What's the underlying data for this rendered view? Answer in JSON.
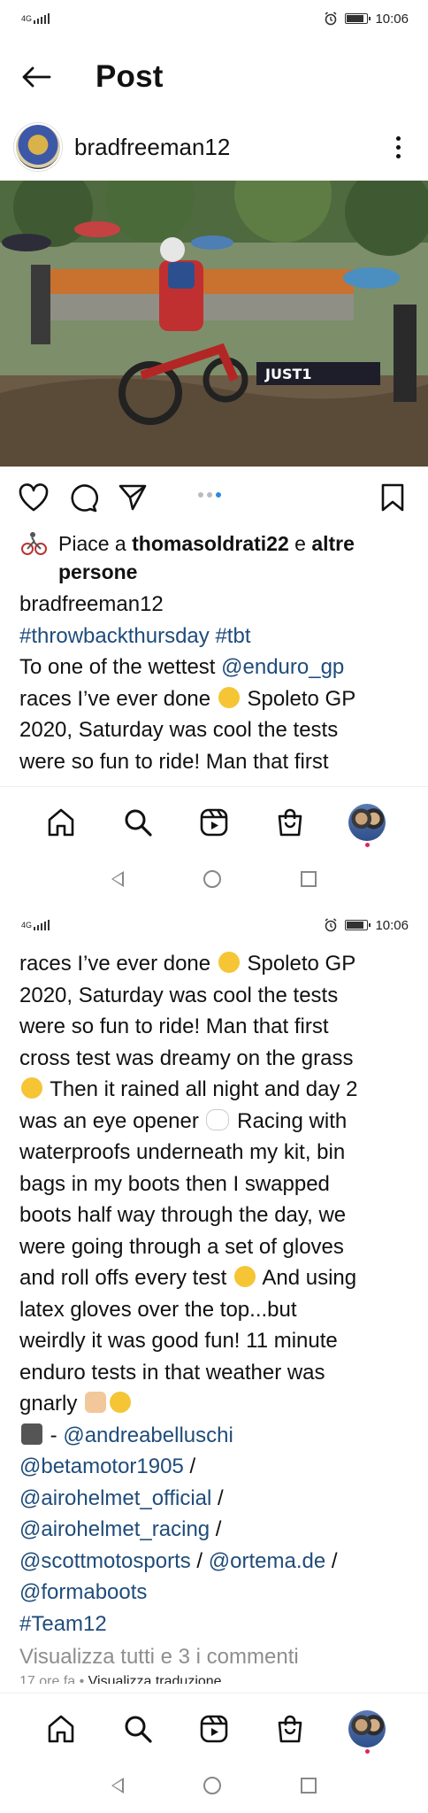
{
  "status": {
    "network": "4G",
    "time": "10:06",
    "battery_level": 0.85
  },
  "header": {
    "title": "Post",
    "back_icon": "arrow-left-icon"
  },
  "post": {
    "username": "bradfreeman12",
    "likes_prefix": "Piace a ",
    "likes_user": "thomasoldrati22",
    "likes_mid": " e ",
    "likes_others": "altre persone",
    "caption_user": "bradfreeman12",
    "hashtags": "#throwbackthursday #tbt",
    "carousel_count": 3,
    "carousel_active": 3,
    "photo_banner": "JUST1",
    "text": {
      "l1a": "To one of the wettest ",
      "l1b": "@enduro_gp",
      "l2": "races I’ve ever done",
      "l2b": " Spoleto GP",
      "l3": "2020, Saturday was cool the tests",
      "l4": "were so fun to ride! Man that first",
      "l5": "cross test was dreamy on the grass",
      "l6": " Then it rained all night and day 2",
      "l7a": "was an eye opener ",
      "l7b": " Racing with",
      "l8": "waterproofs underneath my kit, bin",
      "l9": "bags in my boots then I swapped",
      "l10": "boots half way through the day, we",
      "l11": "were going through a set of gloves",
      "l12a": "and roll offs every test ",
      "l12b": " And using",
      "l13": "latex gloves over the top...but",
      "l14": "weirdly it was good fun! 11 minute",
      "l15": "enduro tests in that weather was",
      "l16": "gnarly ",
      "photo_credit_prefix": " - ",
      "m1": "@andreabelluschi",
      "m2": "@betamotor1905",
      "sep": " /",
      "m3": "@airohelmet_official",
      "m4": "@airohelmet_racing",
      "m5": "@scottmotosports",
      "m6": "@ortema.de",
      "m7": "@formaboots",
      "team": "#Team12"
    },
    "view_comments": "Visualizza tutti e 3 i commenti",
    "time_ago": "17 ore fa",
    "translate_sep": " • ",
    "translate": "Visualizza traduzione"
  },
  "icons": {
    "like": "heart-icon",
    "comment": "comment-icon",
    "share": "send-icon",
    "save": "bookmark-icon",
    "home": "home-icon",
    "search": "search-icon",
    "reels": "reels-icon",
    "shop": "shop-icon"
  }
}
